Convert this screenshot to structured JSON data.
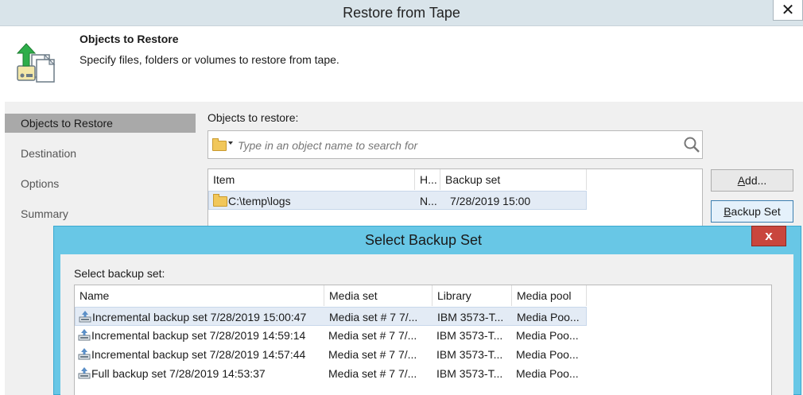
{
  "window": {
    "title": "Restore from Tape",
    "close_glyph": "✕"
  },
  "header": {
    "title": "Objects to Restore",
    "subtitle": "Specify files, folders or volumes to restore from tape.",
    "icon": "restore-wizard-icon"
  },
  "nav": {
    "items": [
      {
        "label": "Objects to Restore",
        "active": true
      },
      {
        "label": "Destination",
        "active": false
      },
      {
        "label": "Options",
        "active": false
      },
      {
        "label": "Summary",
        "active": false
      }
    ]
  },
  "objects": {
    "label": "Objects to restore:",
    "search_placeholder": "Type in an object name to search for",
    "search_icon": "magnifier-icon",
    "columns": [
      "Item",
      "H...",
      "Backup set"
    ],
    "rows": [
      {
        "item": "C:\\temp\\logs",
        "h": "N...",
        "backup_set": "7/28/2019 15:00",
        "selected": true
      }
    ]
  },
  "buttons": {
    "add_prefix": "",
    "add_ul": "A",
    "add_rest": "dd...",
    "backup_set_ul": "B",
    "backup_set_rest": "ackup Set"
  },
  "dialog": {
    "title": "Select Backup Set",
    "close_glyph": "x",
    "label": "Select backup set:",
    "columns": [
      "Name",
      "Media set",
      "Library",
      "Media pool"
    ],
    "rows": [
      {
        "name": "Incremental backup set 7/28/2019 15:00:47",
        "media_set": "Media set # 7 7/...",
        "library": "IBM 3573-T...",
        "media_pool": "Media Poo...",
        "selected": true
      },
      {
        "name": "Incremental backup set 7/28/2019 14:59:14",
        "media_set": "Media set # 7 7/...",
        "library": "IBM 3573-T...",
        "media_pool": "Media Poo...",
        "selected": false
      },
      {
        "name": "Incremental backup set 7/28/2019 14:57:44",
        "media_set": "Media set # 7 7/...",
        "library": "IBM 3573-T...",
        "media_pool": "Media Poo...",
        "selected": false
      },
      {
        "name": "Full backup set 7/28/2019 14:53:37",
        "media_set": "Media set # 7 7/...",
        "library": "IBM 3573-T...",
        "media_pool": "Media Poo...",
        "selected": false
      }
    ]
  },
  "colors": {
    "accent_dialog": "#68c7e6",
    "close_red": "#c9463d",
    "selection": "#e3ebf5",
    "nav_active": "#a9a9a9"
  }
}
